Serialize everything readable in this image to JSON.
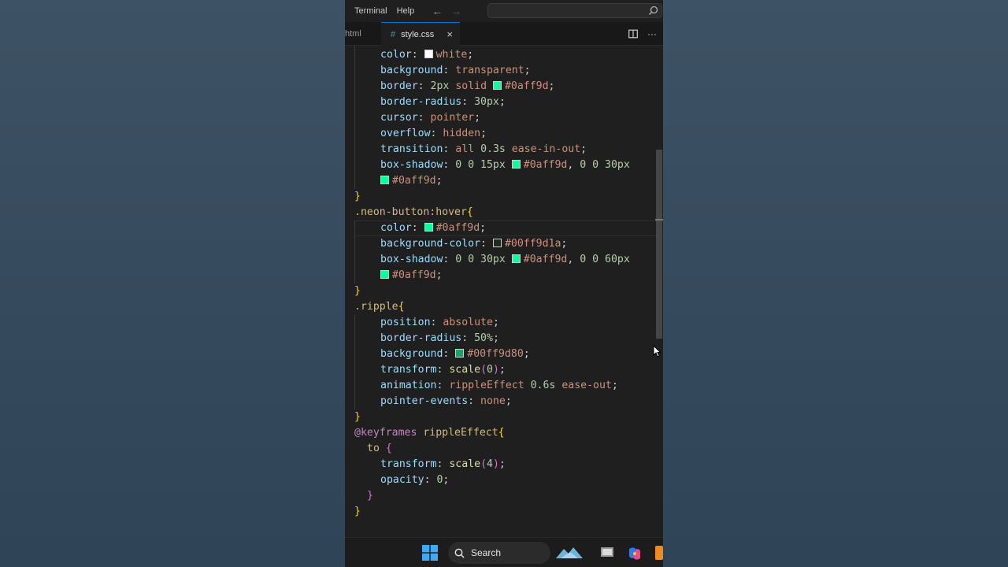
{
  "menu": {
    "items": [
      "Terminal",
      "Help"
    ]
  },
  "tabs": {
    "inactive_label": "html",
    "active_label": "style.css",
    "active_icon": "#",
    "close_glyph": "×"
  },
  "code": {
    "l1": {
      "p": "color",
      "sw": "#ffffff",
      "v": "white"
    },
    "l2": {
      "p": "background",
      "v": "transparent"
    },
    "l3": {
      "p": "border",
      "n": "2px",
      "k": "solid",
      "sw": "#0aff9d",
      "v": "#0aff9d"
    },
    "l4": {
      "p": "border-radius",
      "n": "30px"
    },
    "l5": {
      "p": "cursor",
      "v": "pointer"
    },
    "l6": {
      "p": "overflow",
      "v": "hidden"
    },
    "l7": {
      "p": "transition",
      "v1": "all",
      "n": "0.3s",
      "v2": "ease-in-out"
    },
    "l8": {
      "p": "box-shadow",
      "n1": "0 0 15px",
      "sw": "#0aff9d",
      "v1": "#0aff9d",
      "n2": "0 0 30px"
    },
    "l9": {
      "sw": "#0aff9d",
      "v": "#0aff9d"
    },
    "l10": {
      "b": "}"
    },
    "l11": {
      "s": ".neon-button:hover",
      "b": "{"
    },
    "l12": {
      "p": "color",
      "sw": "#0aff9d",
      "v": "#0aff9d"
    },
    "l13": {
      "p": "background-color",
      "sw": "#00ff9d1a",
      "v": "#00ff9d1a"
    },
    "l14": {
      "p": "box-shadow",
      "n1": "0 0 30px",
      "sw": "#0aff9d",
      "v1": "#0aff9d",
      "n2": "0 0 60px"
    },
    "l15": {
      "sw": "#0aff9d",
      "v": "#0aff9d"
    },
    "l16": {
      "b": "}"
    },
    "l17": {
      "s": ".ripple",
      "b": "{"
    },
    "l18": {
      "p": "position",
      "v": "absolute"
    },
    "l19": {
      "p": "border-radius",
      "n": "50%"
    },
    "l20": {
      "p": "background",
      "sw": "#00ff9d80",
      "v": "#00ff9d80"
    },
    "l21": {
      "p": "transform",
      "f": "scale",
      "n": "0"
    },
    "l22": {
      "p": "animation",
      "f": "rippleEffect",
      "n": "0.6s",
      "v": "ease-out"
    },
    "l23": {
      "p": "pointer-events",
      "v": "none"
    },
    "l24": {
      "b": "}"
    },
    "l25": {
      "at": "@keyframes",
      "s": "rippleEffect",
      "b": "{"
    },
    "l26": {
      "s": "to",
      "b": "{"
    },
    "l27": {
      "p": "transform",
      "f": "scale",
      "n": "4"
    },
    "l28": {
      "p": "opacity",
      "n": "0"
    },
    "l29": {
      "b": "}"
    },
    "l30": {
      "b": "}"
    }
  },
  "taskbar": {
    "search_label": "Search"
  },
  "colors": {
    "accent_tab_border": "#0078d4",
    "neon": "#0aff9d"
  }
}
